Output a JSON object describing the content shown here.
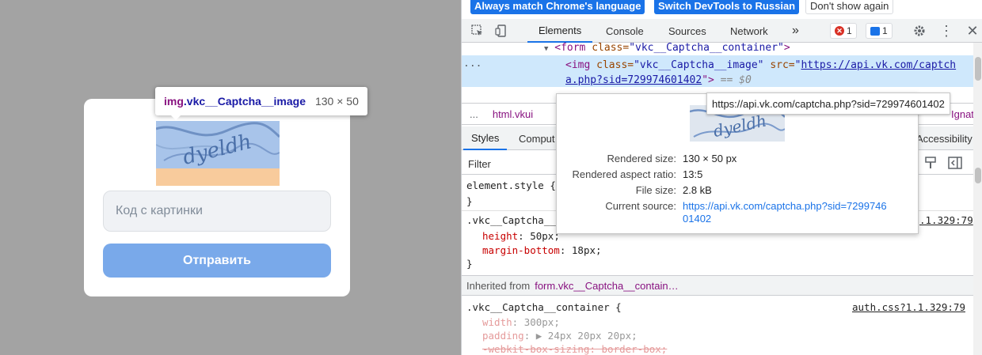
{
  "page": {
    "captcha_input_placeholder": "Код с картинки",
    "submit_label": "Отправить",
    "captcha_text": "dyeldh"
  },
  "inspect_tooltip": {
    "tag": "img",
    "class": ".vkc__Captcha__image",
    "dims": "130 × 50"
  },
  "infobar": {
    "btn_match_language": "Always match Chrome's language",
    "btn_switch_russian": "Switch DevTools to Russian",
    "btn_dont_show": "Don't show again"
  },
  "toolbar": {
    "tabs": [
      "Elements",
      "Console",
      "Sources",
      "Network"
    ],
    "more": "»",
    "error_count": "1",
    "message_count": "1"
  },
  "dom": {
    "form_line_open": "<form",
    "form_attr": "class=",
    "form_val": "\"vkc__Captcha__container\"",
    "form_close": ">",
    "img_open": "<img",
    "img_class_attr": "class=",
    "img_class_val": "\"vkc__Captcha__image\"",
    "img_src_attr": "src=",
    "img_src_part1": "https://api.vk.com/captch",
    "img_src_part2": "a.php?sid=729974601402",
    "img_close": "\">",
    "eq_marker": "== $0",
    "dots": "..."
  },
  "crumbs": {
    "dots": "...",
    "html": "html.vkui",
    "right_part": "Ignature"
  },
  "subtabs": {
    "styles": "Styles",
    "computed": "Comput",
    "accessibility": "Accessibility"
  },
  "filter": {
    "placeholder": "Filter"
  },
  "styles": {
    "element_style": "element.style {",
    "close1": "}",
    "rule1_selector": ".vkc__Captcha__",
    "rule1_src": ".1.329:79",
    "rule1_props": [
      {
        "name": "height",
        "value": "50px;"
      },
      {
        "name": "margin-bottom",
        "value": "18px;"
      }
    ],
    "close2": "}",
    "inherited_label": "Inherited from",
    "inherited_link": "form.vkc__Captcha__contain…",
    "rule2_selector": ".vkc__Captcha__container {",
    "rule2_src": "auth.css?1.1.329:79",
    "rule2_props": [
      {
        "name": "width",
        "value": "300px;"
      },
      {
        "name": "padding",
        "value": "▶ 24px 20px 20px;"
      },
      {
        "name": "-webkit-box-sizing",
        "value": "border-box;"
      }
    ]
  },
  "url_tooltip": "https://api.vk.com/captcha.php?sid=729974601402",
  "image_tooltip": {
    "rendered_size_label": "Rendered size:",
    "rendered_size": "130 × 50 px",
    "aspect_label": "Rendered aspect ratio:",
    "aspect": "13:5",
    "file_size_label": "File size:",
    "file_size": "2.8 kB",
    "source_label": "Current source:",
    "source_line1": "https://api.vk.com/captcha.php?sid=7299746",
    "source_line2": "01402"
  },
  "colors": {
    "accent": "#1a73e8",
    "submit": "#79a9ea",
    "selection": "#cfe8fc"
  }
}
